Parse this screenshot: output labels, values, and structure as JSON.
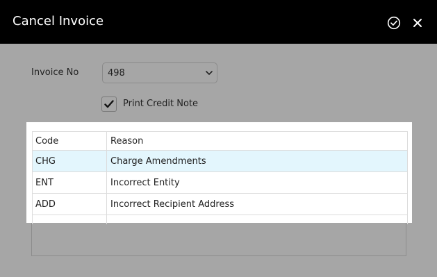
{
  "dialog": {
    "title": "Cancel Invoice",
    "confirm_icon": "check-circle-icon",
    "close_icon": "close-icon"
  },
  "form": {
    "invoice_label": "Invoice No",
    "invoice_value": "498",
    "print_credit_note_label": "Print Credit Note",
    "print_credit_note_checked": true
  },
  "table": {
    "headers": [
      "Code",
      "Reason"
    ],
    "rows": [
      {
        "code": "CHG",
        "reason": "Charge Amendments",
        "selected": true
      },
      {
        "code": "ENT",
        "reason": "Incorrect Entity",
        "selected": false
      },
      {
        "code": "ADD",
        "reason": "Incorrect Recipient Address",
        "selected": false
      }
    ]
  },
  "colors": {
    "titlebar": "#000000",
    "overlay": "#a6a6a6",
    "selected_row": "#e3f6fd"
  }
}
